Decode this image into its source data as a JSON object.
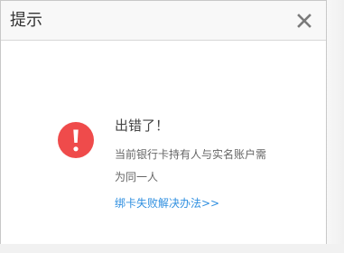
{
  "dialog": {
    "title": "提示",
    "close_icon": "close-icon",
    "message_title": "出错了！",
    "message_text": "当前银行卡持有人与实名账户需为同一人",
    "help_link": "绑卡失败解决办法>>",
    "error_icon": "error-icon"
  },
  "colors": {
    "dialog_bg": "#ffffff",
    "header_bg": "#f8f8f8",
    "border": "#c8c8c8",
    "title_text": "#333333",
    "body_text": "#666666",
    "error_red": "#ef4b4b",
    "link_blue": "#2f8fe0",
    "close_icon": "#7a7a7a"
  }
}
